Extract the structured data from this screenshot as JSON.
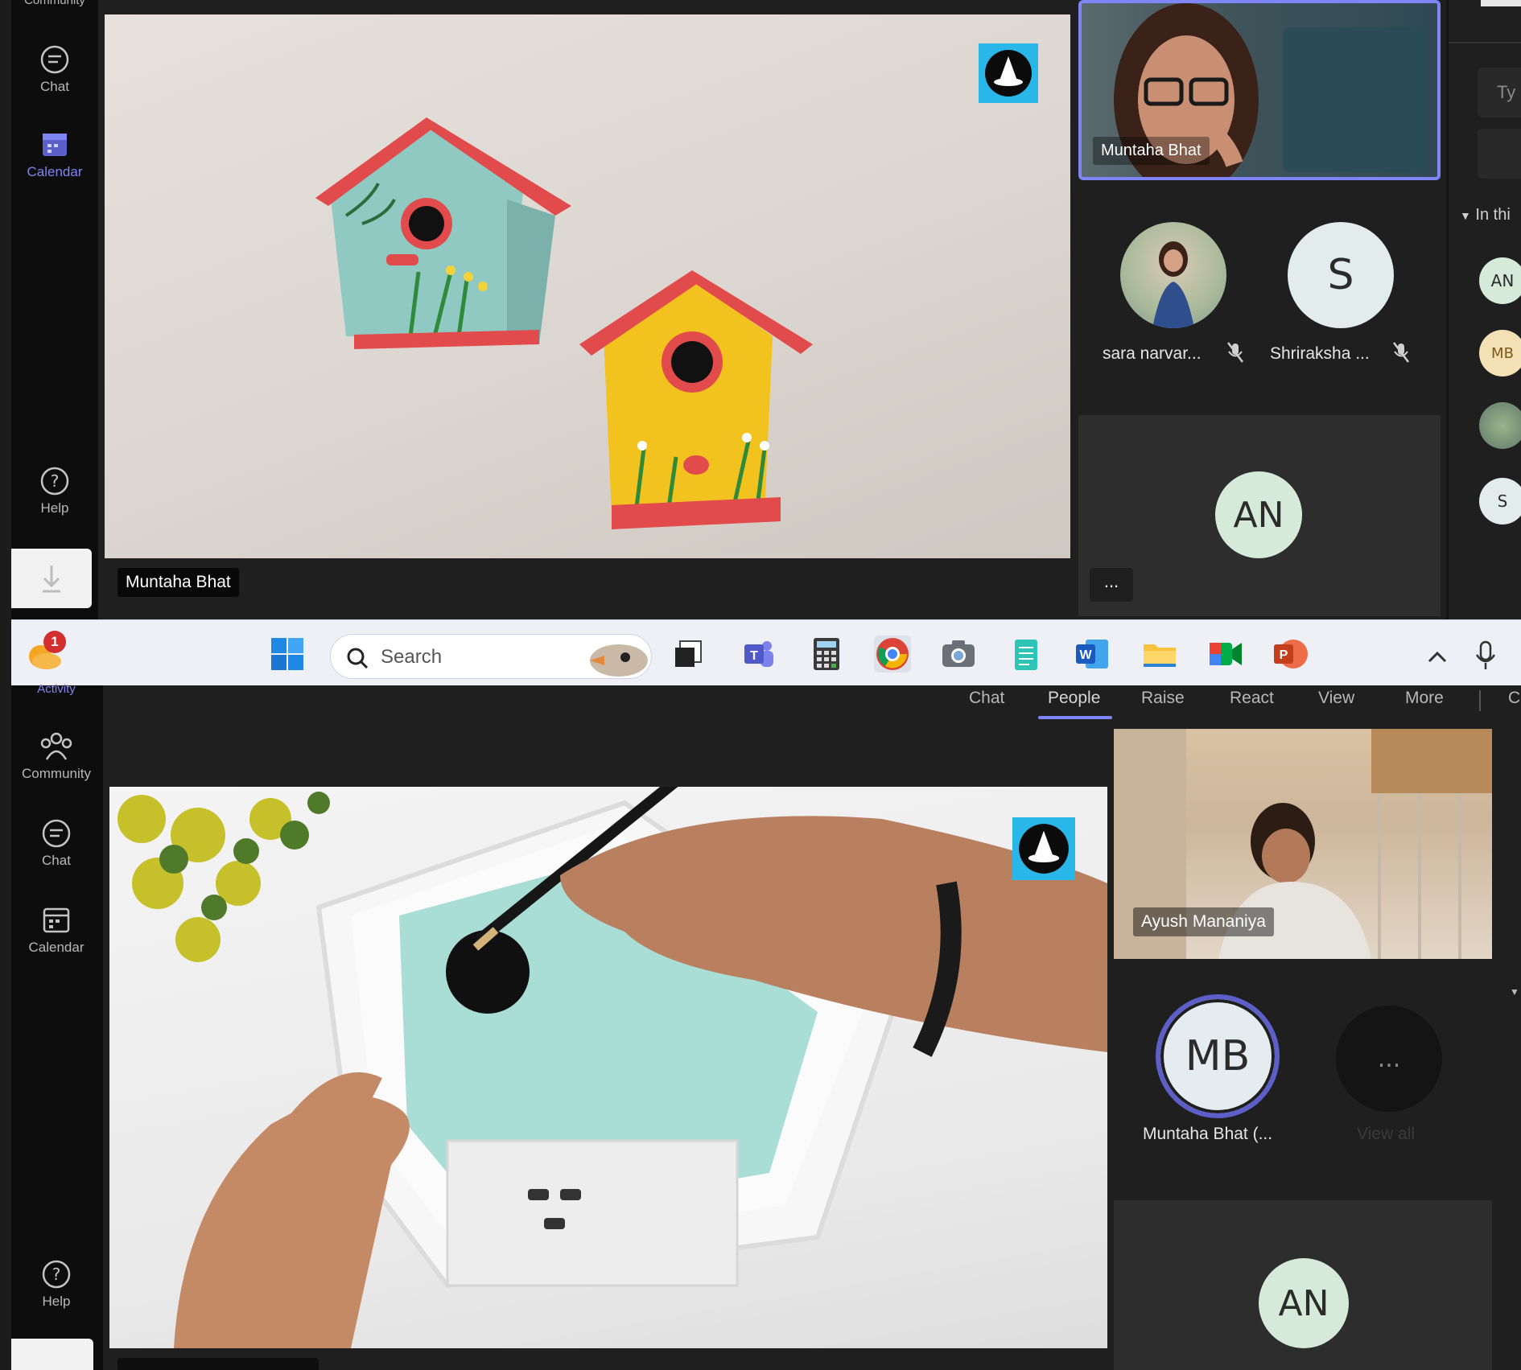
{
  "top": {
    "rail": {
      "partial_label": "Community",
      "chat_label": "Chat",
      "calendar_label": "Calendar",
      "help_label": "Help"
    },
    "main_video": {
      "name": "Muntaha Bhat"
    },
    "self_video": {
      "name": "Muntaha Bhat"
    },
    "participants": [
      {
        "name": "sara narvar...",
        "initials": ""
      },
      {
        "name": "Shriraksha ...",
        "initials": "S"
      }
    ],
    "extra_tile": {
      "initials": "AN"
    },
    "more_label": "...",
    "side_panel": {
      "search_placeholder": "Ty",
      "section_label": "In thi",
      "people_initials": [
        "AN",
        "MB",
        "",
        "S"
      ]
    }
  },
  "taskbar": {
    "notification_count": "1",
    "search_placeholder": "Search",
    "apps": [
      "start-icon",
      "task-view-icon",
      "teams-icon",
      "calculator-icon",
      "chrome-icon",
      "camera-icon",
      "notepad-icon",
      "word-icon",
      "file-explorer-icon",
      "meet-icon",
      "powerpoint-icon"
    ]
  },
  "bottom": {
    "rail": {
      "partial_label": "Activity",
      "community_label": "Community",
      "chat_label": "Chat",
      "calendar_label": "Calendar",
      "help_label": "Help"
    },
    "tabs": {
      "chat": "Chat",
      "people": "People",
      "raise": "Raise",
      "react": "React",
      "view": "View",
      "more": "More",
      "partial": "C"
    },
    "ayush_video": {
      "name": "Ayush Mananiya"
    },
    "mb_tile": {
      "initials": "MB",
      "name": "Muntaha Bhat (..."
    },
    "view_all": {
      "icon": "...",
      "label": "View all"
    },
    "an_tile": {
      "initials": "AN"
    }
  },
  "colors": {
    "accent": "#7f85f5",
    "panel": "#292929",
    "rail": "#0d0d0d",
    "taskbar": "#eef0f6"
  }
}
